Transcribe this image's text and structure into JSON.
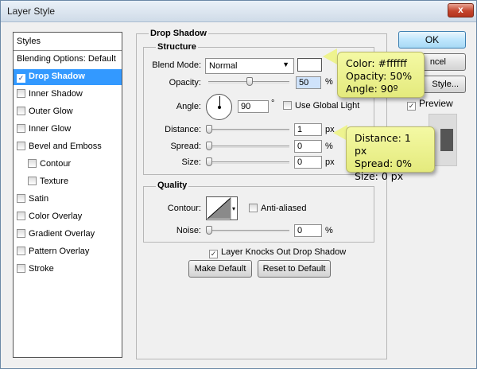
{
  "window": {
    "title": "Layer Style",
    "close_label": "x"
  },
  "styles_panel": {
    "header": "Styles",
    "items": [
      {
        "label": "Blending Options: Default",
        "checkbox": false,
        "checked": false,
        "selected": false,
        "sub": false
      },
      {
        "label": "Drop Shadow",
        "checkbox": true,
        "checked": true,
        "selected": true,
        "sub": false
      },
      {
        "label": "Inner Shadow",
        "checkbox": true,
        "checked": false,
        "selected": false,
        "sub": false
      },
      {
        "label": "Outer Glow",
        "checkbox": true,
        "checked": false,
        "selected": false,
        "sub": false
      },
      {
        "label": "Inner Glow",
        "checkbox": true,
        "checked": false,
        "selected": false,
        "sub": false
      },
      {
        "label": "Bevel and Emboss",
        "checkbox": true,
        "checked": false,
        "selected": false,
        "sub": false
      },
      {
        "label": "Contour",
        "checkbox": true,
        "checked": false,
        "selected": false,
        "sub": true
      },
      {
        "label": "Texture",
        "checkbox": true,
        "checked": false,
        "selected": false,
        "sub": true
      },
      {
        "label": "Satin",
        "checkbox": true,
        "checked": false,
        "selected": false,
        "sub": false
      },
      {
        "label": "Color Overlay",
        "checkbox": true,
        "checked": false,
        "selected": false,
        "sub": false
      },
      {
        "label": "Gradient Overlay",
        "checkbox": true,
        "checked": false,
        "selected": false,
        "sub": false
      },
      {
        "label": "Pattern Overlay",
        "checkbox": true,
        "checked": false,
        "selected": false,
        "sub": false
      },
      {
        "label": "Stroke",
        "checkbox": true,
        "checked": false,
        "selected": false,
        "sub": false
      }
    ]
  },
  "drop_shadow": {
    "title": "Drop Shadow",
    "structure": {
      "title": "Structure",
      "blend_mode_label": "Blend Mode:",
      "blend_mode_value": "Normal",
      "shadow_color": "#ffffff",
      "opacity_label": "Opacity:",
      "opacity_value": "50",
      "opacity_unit": "%",
      "opacity_level": 0.5,
      "angle_label": "Angle:",
      "angle_value": "90",
      "angle_unit": "°",
      "use_global_light_label": "Use Global Light",
      "distance_label": "Distance:",
      "distance_value": "1",
      "distance_unit": "px",
      "spread_label": "Spread:",
      "spread_value": "0",
      "spread_unit": "%",
      "size_label": "Size:",
      "size_value": "0",
      "size_unit": "px"
    },
    "quality": {
      "title": "Quality",
      "contour_label": "Contour:",
      "anti_aliased_label": "Anti-aliased",
      "noise_label": "Noise:",
      "noise_value": "0",
      "noise_unit": "%"
    },
    "knocks_out_label": "Layer Knocks Out Drop Shadow",
    "make_default_label": "Make Default",
    "reset_default_label": "Reset to Default"
  },
  "right_buttons": {
    "ok_label": "OK",
    "cancel_label": "ncel",
    "new_style_label": "Style...",
    "preview_label": "Preview"
  },
  "tooltips": [
    {
      "lines": [
        "Color: #ffffff",
        "Opacity: 50%",
        "Angle: 90º"
      ]
    },
    {
      "lines": [
        "Distance: 1 px",
        "Spread: 0%",
        "Size: 0 px"
      ]
    }
  ]
}
